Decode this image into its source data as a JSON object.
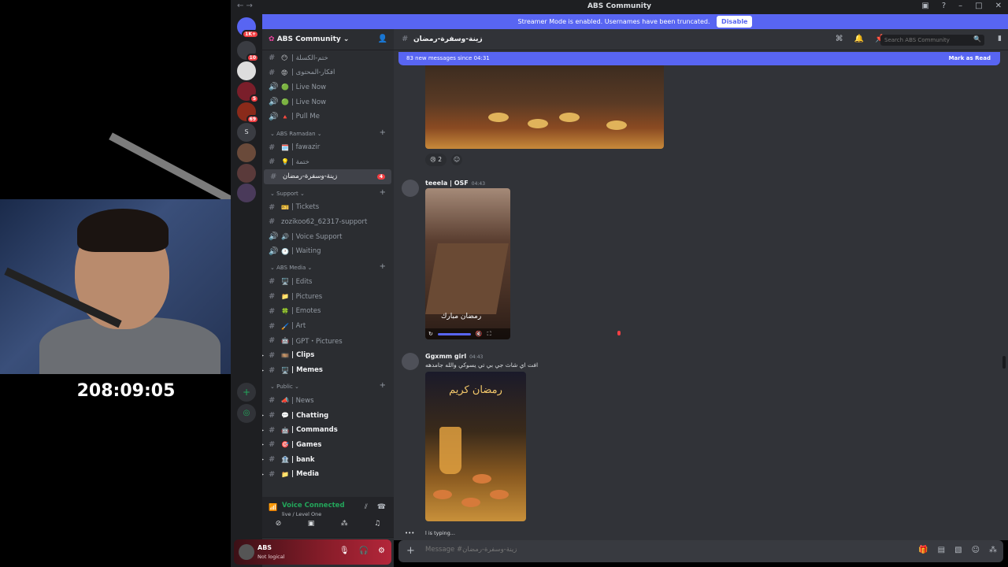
{
  "window": {
    "title": "ABS Community"
  },
  "streamer_banner": {
    "text": "Streamer Mode is enabled. Usernames have been truncated.",
    "disable_label": "Disable"
  },
  "stream_overlay": {
    "timer": "208:09:05"
  },
  "guild_rail": {
    "badges": [
      "1K+",
      "10",
      "5",
      "69",
      "S",
      "60"
    ]
  },
  "server": {
    "name": "ABS Community ⌄"
  },
  "channels": {
    "items": [
      {
        "type": "text",
        "emoji": "😶",
        "name": "| ختم-الكسلة"
      },
      {
        "type": "text",
        "emoji": "😡",
        "name": "| افكار-المحتوى"
      },
      {
        "type": "voice",
        "emoji": "🟢",
        "name": "| Live Now"
      },
      {
        "type": "voice",
        "emoji": "🟢",
        "name": "| Live Now"
      },
      {
        "type": "voice",
        "emoji": "🔺",
        "name": "| Pull Me"
      },
      {
        "type": "category",
        "name": "⌄ ABS Ramadan ⌄"
      },
      {
        "type": "text",
        "emoji": "🗓️",
        "name": "| fawazir"
      },
      {
        "type": "text",
        "emoji": "💡",
        "name": "| ختمة"
      },
      {
        "type": "text",
        "emoji": "",
        "name": "زينة-وسفرة-رمضان",
        "selected": true,
        "count": "4"
      },
      {
        "type": "category",
        "name": "⌄ Support ⌄"
      },
      {
        "type": "text",
        "emoji": "🎫",
        "name": "| Tickets"
      },
      {
        "type": "text",
        "emoji": "",
        "name": "zozikoo62_62317-support"
      },
      {
        "type": "voice",
        "emoji": "🔊",
        "name": "| Voice Support"
      },
      {
        "type": "voice",
        "emoji": "🕐",
        "name": "| Waiting"
      },
      {
        "type": "category",
        "name": "⌄ ABS Media ⌄"
      },
      {
        "type": "text",
        "emoji": "🖥️",
        "name": "| Edits"
      },
      {
        "type": "text",
        "emoji": "📁",
        "name": "| Pictures"
      },
      {
        "type": "text",
        "emoji": "🍀",
        "name": "| Emotes"
      },
      {
        "type": "text",
        "emoji": "🖌️",
        "name": "| Art"
      },
      {
        "type": "text",
        "emoji": "🤖",
        "name": "| GPT・Pictures"
      },
      {
        "type": "text",
        "emoji": "🎞️",
        "name": "| Clips",
        "bold": true
      },
      {
        "type": "text",
        "emoji": "🖥️",
        "name": "| Memes",
        "bold": true
      },
      {
        "type": "category",
        "name": "⌄ Public ⌄"
      },
      {
        "type": "text",
        "emoji": "📣",
        "name": "| News"
      },
      {
        "type": "text",
        "emoji": "💬",
        "name": "| Chatting",
        "bold": true
      },
      {
        "type": "text",
        "emoji": "🤖",
        "name": "| Commands",
        "bold": true
      },
      {
        "type": "text",
        "emoji": "🎯",
        "name": "| Games",
        "bold": true
      },
      {
        "type": "text",
        "emoji": "🏦",
        "name": "| bank",
        "bold": true
      },
      {
        "type": "text",
        "emoji": "📁",
        "name": "| Media",
        "bold": true
      }
    ]
  },
  "voice_panel": {
    "status": "Voice Connected",
    "sub": "live / Level One"
  },
  "user_panel": {
    "name": "ABS",
    "status": "Not logical"
  },
  "chat_header": {
    "channel": "زينة-وسفرة-رمضان",
    "search_placeholder": "Search ABS Community"
  },
  "chat": {
    "new_messages": "83 new messages since 04:31",
    "mark_as_read": "Mark as Read",
    "reaction_count": "2",
    "messages": [
      {
        "author": "teeela | OSF",
        "time": "04:43",
        "video_caption": "رمضان مبارك"
      },
      {
        "author": "Ggxmm girl",
        "time": "04:43",
        "text": "افت اي شاث جي بي تي يسوكي والله جامدهه",
        "image_caption": "رمضان كريم"
      }
    ],
    "typing": "l is typing..."
  },
  "composer": {
    "placeholder": "Message #زينة-وسفرة-رمضان"
  }
}
